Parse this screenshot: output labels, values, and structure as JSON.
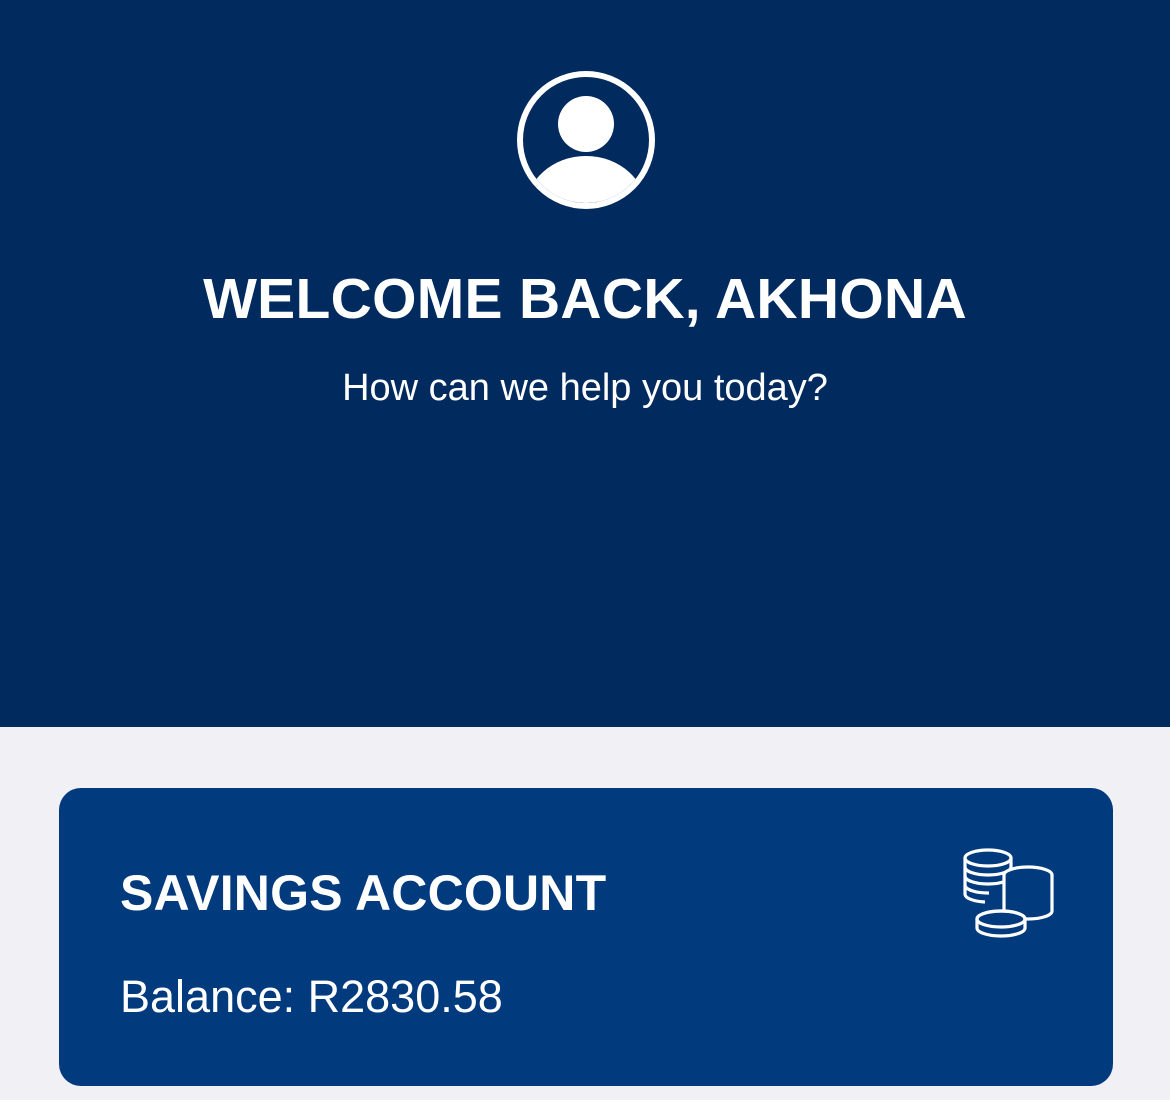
{
  "header": {
    "icon": "user-avatar-icon",
    "welcome_text": "WELCOME BACK, AKHONA",
    "subtitle": "How can we help you today?",
    "background_color": "#012a5e"
  },
  "account_card": {
    "title": "SAVINGS ACCOUNT",
    "balance": "Balance: R2830.58",
    "icon": "coins-stack-icon",
    "background_color": "#023a7e"
  },
  "page": {
    "background_color": "#f1f0f5"
  }
}
